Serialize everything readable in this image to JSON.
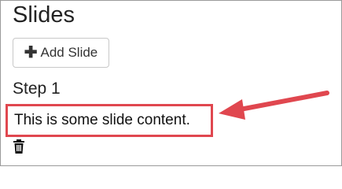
{
  "page": {
    "title": "Slides",
    "add_button_label": "Add Slide",
    "add_button_icon": "plus-icon"
  },
  "slides": [
    {
      "step_label": "Step 1",
      "content": "This is some slide content.",
      "delete_icon": "trash-icon"
    }
  ],
  "annotations": {
    "highlight_color": "#e0474f",
    "arrow_color": "#e0474f"
  }
}
